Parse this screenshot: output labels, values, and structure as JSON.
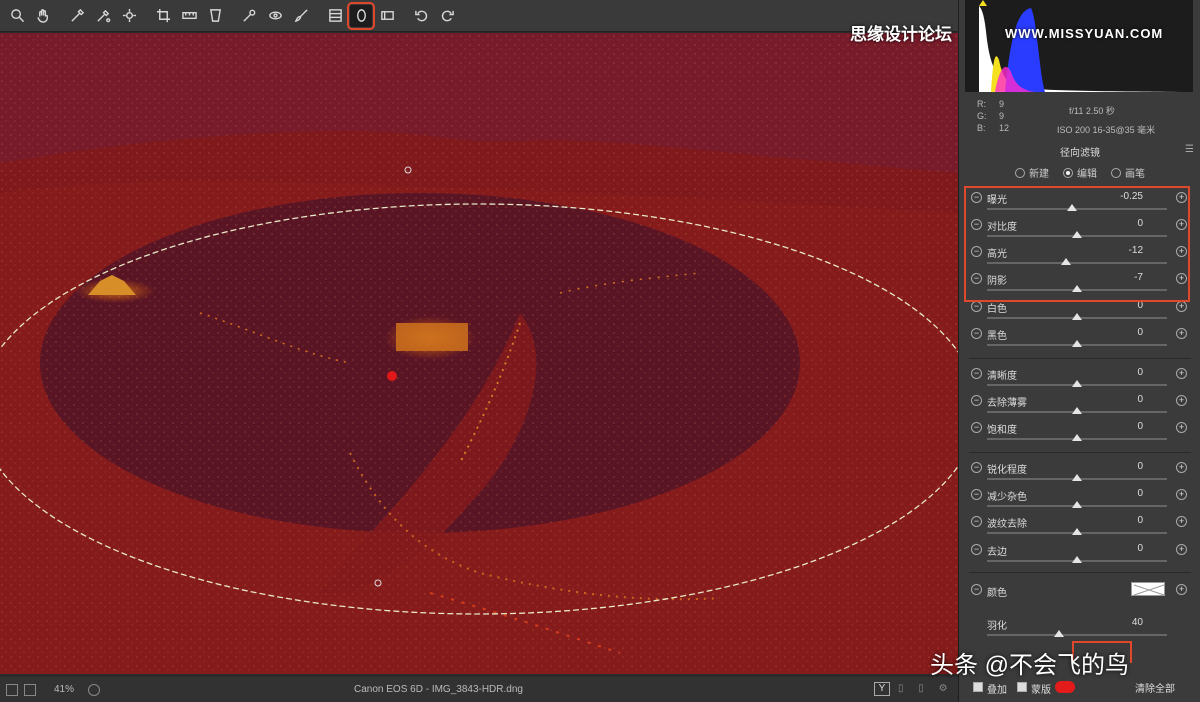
{
  "toolbar": {
    "tools": [
      {
        "name": "zoom-tool-icon"
      },
      {
        "name": "hand-tool-icon"
      },
      {
        "name": "white-balance-tool-icon"
      },
      {
        "name": "color-sampler-icon"
      },
      {
        "name": "targeted-adjustment-icon"
      },
      {
        "name": "crop-tool-icon"
      },
      {
        "name": "straighten-tool-icon"
      },
      {
        "name": "transform-tool-icon"
      },
      {
        "name": "spot-removal-icon"
      },
      {
        "name": "red-eye-icon"
      },
      {
        "name": "adjustment-brush-icon"
      },
      {
        "name": "graduated-filter-icon"
      },
      {
        "name": "radial-filter-icon",
        "active": true
      },
      {
        "name": "open-preferences-icon"
      },
      {
        "name": "rotate-left-icon"
      },
      {
        "name": "rotate-right-icon"
      }
    ]
  },
  "watermarks": {
    "top": "思缘设计论坛",
    "url": "WWW.MISSYUAN.COM",
    "bottom": "头条 @不会飞的鸟"
  },
  "status": {
    "zoom": "41%",
    "filename": "Canon EOS 6D - IMG_3843-HDR.dng",
    "view_toggle": "Y"
  },
  "camera_info": {
    "r_label": "R:",
    "r_value": "9",
    "g_label": "G:",
    "g_value": "9",
    "b_label": "B:",
    "b_value": "12",
    "aperture_shutter": "f/11   2.50 秒",
    "iso_lens": "ISO 200   16-35@35 毫米"
  },
  "panel": {
    "title": "径向滤镜",
    "modes": [
      {
        "label": "新建",
        "selected": false
      },
      {
        "label": "编辑",
        "selected": true
      },
      {
        "label": "画笔",
        "selected": false
      }
    ],
    "sliders": [
      {
        "label": "曝光",
        "value": "-0.25",
        "pos": 0.47
      },
      {
        "label": "对比度",
        "value": "0",
        "pos": 0.5
      },
      {
        "label": "高光",
        "value": "-12",
        "pos": 0.44
      },
      {
        "label": "阴影",
        "value": "-7",
        "pos": 0.5
      },
      {
        "label": "白色",
        "value": "0",
        "pos": 0.5
      },
      {
        "label": "黑色",
        "value": "0",
        "pos": 0.5
      },
      {
        "label": "清晰度",
        "value": "0",
        "pos": 0.5
      },
      {
        "label": "去除薄雾",
        "value": "0",
        "pos": 0.5
      },
      {
        "label": "饱和度",
        "value": "0",
        "pos": 0.5
      },
      {
        "label": "锐化程度",
        "value": "0",
        "pos": 0.5
      },
      {
        "label": "减少杂色",
        "value": "0",
        "pos": 0.5
      },
      {
        "label": "波纹去除",
        "value": "0",
        "pos": 0.5
      },
      {
        "label": "去边",
        "value": "0",
        "pos": 0.5
      }
    ],
    "color_label": "颜色",
    "feather": {
      "label": "羽化",
      "value": "40",
      "pos": 0.4
    },
    "overlay_label": "叠加",
    "mask_label": "蒙版",
    "clear_all": "清除全部"
  },
  "colors": {
    "accent_red": "#e0482e",
    "mask_overlay": "#8b1a1a",
    "mask_swatch": "#e41b1b"
  }
}
